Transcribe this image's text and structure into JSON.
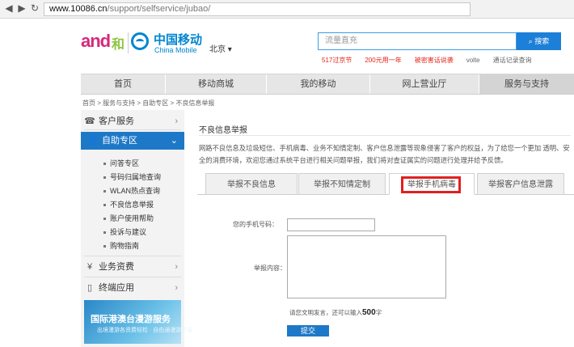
{
  "browser": {
    "url_host": "www.10086.cn",
    "url_path": "/support/selfservice/jubao/"
  },
  "header": {
    "logo_and": "and",
    "logo_he": "和",
    "brand_cn": "中国移动",
    "brand_en": "China Mobile",
    "city": "北京",
    "search_placeholder": "流量直充",
    "search_button": "搜索",
    "hot_links": [
      "517过京节",
      "200元用一年",
      "被密害话说袭",
      "volte",
      "通话记录查询"
    ]
  },
  "nav": {
    "items": [
      "首页",
      "移动商城",
      "我的移动",
      "网上营业厅",
      "服务与支持"
    ]
  },
  "breadcrumb": "首页 > 服务与支持 > 自助专区 > 不良信息举报",
  "sidebar": {
    "customer_service": "客户服务",
    "self_service": "自助专区",
    "sub_items": [
      "问答专区",
      "号码归属地查询",
      "WLAN热点查询",
      "不良信息举报",
      "账户使用帮助",
      "投诉与建议",
      "购物指南"
    ],
    "business_fees": "业务资费",
    "terminal_apps": "终端应用",
    "banner_title": "国际港澳台漫游服务",
    "banner_sub": "出境漫游各资费轻松 · 自由通漫游更省"
  },
  "content": {
    "title": "不良信息举报",
    "description": "网路不良信息及垃圾短信、手机病毒、业务不知情定制、客户信息泄露等现象侵害了客户的权益，为了给您一个更加 透明、安全的消费环境，欢迎您通过系统平台进行相关问题举报，我们将对查证属实的问题进行处理并给予反馈。",
    "tabs": [
      "举报不良信息",
      "举报不知情定制",
      "举报手机病毒",
      "举报客户信息泄露"
    ],
    "phone_label": "您的手机号码：",
    "content_label": "举报内容：",
    "hint_prefix": "请您文明发言，还可以输入",
    "hint_count": "500",
    "hint_suffix": "字",
    "submit": "提交"
  }
}
